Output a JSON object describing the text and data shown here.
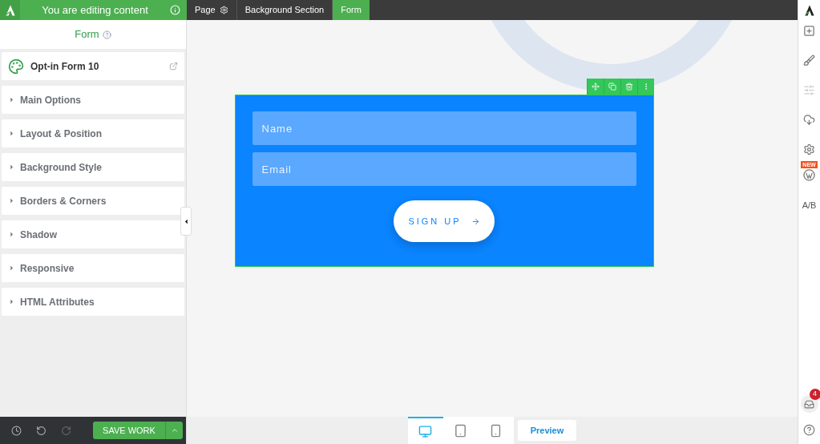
{
  "top_bar": {
    "notice": "You are editing content",
    "breadcrumbs": [
      {
        "label": "Page",
        "selected": false,
        "kind": "page"
      },
      {
        "label": "Background Section",
        "selected": false,
        "kind": "section"
      },
      {
        "label": "Form",
        "selected": true,
        "kind": "element"
      }
    ]
  },
  "panel": {
    "title": "Form",
    "element": "Opt-in Form 10",
    "sections": [
      {
        "label": "Main Options",
        "expanded": false
      },
      {
        "label": "Layout & Position",
        "expanded": false
      },
      {
        "label": "Background Style",
        "expanded": false
      },
      {
        "label": "Borders & Corners",
        "expanded": false
      },
      {
        "label": "Shadow",
        "expanded": false
      },
      {
        "label": "Responsive",
        "expanded": false
      },
      {
        "label": "HTML Attributes",
        "expanded": false
      }
    ]
  },
  "footer": {
    "save_label": "SAVE WORK",
    "devices": [
      {
        "kind": "desktop",
        "selected": true
      },
      {
        "kind": "tablet",
        "selected": false
      },
      {
        "kind": "mobile",
        "selected": false
      }
    ],
    "preview": "Preview"
  },
  "form": {
    "fields": [
      {
        "placeholder": "Name"
      },
      {
        "placeholder": "Email"
      }
    ],
    "button": "SIGN UP"
  },
  "right_bar": {
    "new_badge": "NEW",
    "ab_label": "A/B",
    "notification_count": "4"
  }
}
